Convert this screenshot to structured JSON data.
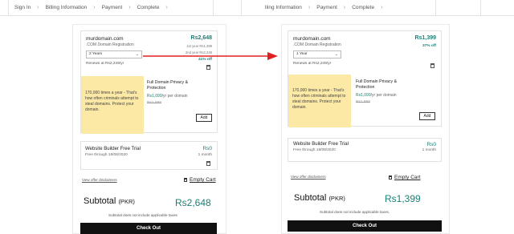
{
  "left": {
    "steps": [
      "Sign In",
      "Billing Information",
      "Payment",
      "Complete"
    ],
    "domain": {
      "name": "murdomain.com",
      "subtitle": ".COM Domain Registration",
      "price": "Rs2,648",
      "first_year": "1st year Rs1,399",
      "second_line": "2nd year Rs2,249",
      "discount": "41% off",
      "term": "2 Years",
      "renews": "Renews at Rs2,249/yr"
    },
    "privacy": {
      "pitch": "170,000 times a year - That's how often criminals attempt to steal domains. Protect your domain.",
      "title": "Full Domain Privacy & Protection",
      "price": "Rs1,099",
      "per": "/yr per domain",
      "strike": "Rs1,899",
      "add": "Add"
    },
    "website_builder": {
      "name": "Website Builder Free Trial",
      "sub": "Free through 18/08/2020",
      "price": "Rs0",
      "period": "1 month"
    },
    "disclaimer": "View offer disclaimers",
    "empty_cart": "Empty Cart",
    "subtotal_label": "Subtotal",
    "subtotal_currency": "(PKR)",
    "subtotal_value": "Rs2,648",
    "taxes": "Subtotal does not include applicable taxes",
    "checkout": "Check Out"
  },
  "right": {
    "steps": [
      "lling Information",
      "Payment",
      "Complete"
    ],
    "domain": {
      "name": "murdomain.com",
      "subtitle": ".COM Domain Registration",
      "price": "Rs1,399",
      "discount": "37% off",
      "term": "1 Year",
      "renews": "Renews at Rs2,249/yr"
    },
    "privacy": {
      "pitch": "170,000 times a year - That's how often criminals attempt to steal domains. Protect your domain.",
      "title": "Full Domain Privacy & Protection",
      "price": "Rs1,099",
      "per": "/yr per domain",
      "strike": "Rs1,899",
      "add": "Add"
    },
    "website_builder": {
      "name": "Website Builder Free Trial",
      "sub": "Free through 18/08/2020",
      "price": "Rs0",
      "period": "1 month"
    },
    "disclaimer": "View offer disclaimers",
    "empty_cart": "Empty Cart",
    "subtotal_label": "Subtotal",
    "subtotal_currency": "(PKR)",
    "subtotal_value": "Rs1,399",
    "taxes": "Subtotal does not include applicable taxes.",
    "checkout": "Check Out"
  },
  "colors": {
    "accent": "#1a7f75",
    "highlight": "#fde9a6",
    "arrow": "#e02020",
    "button": "#111111"
  }
}
